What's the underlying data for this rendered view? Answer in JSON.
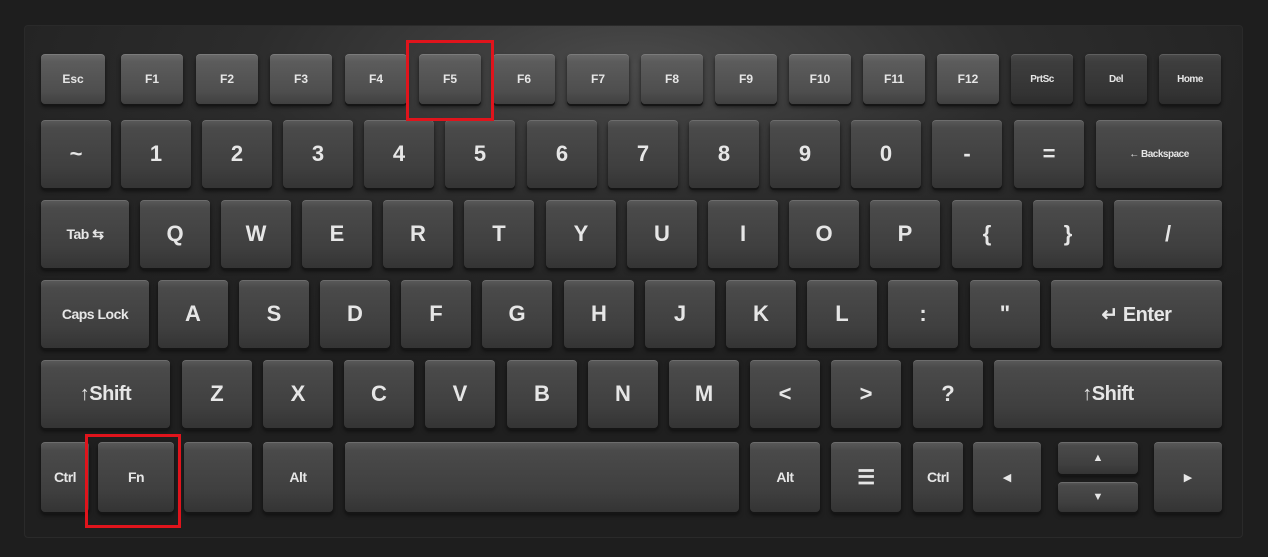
{
  "keyboard": {
    "row_function": [
      "Esc",
      "F1",
      "F2",
      "F3",
      "F4",
      "F5",
      "F6",
      "F7",
      "F8",
      "F9",
      "F10",
      "F11",
      "F12",
      "PrtSc",
      "Del",
      "Home"
    ],
    "row_number": [
      "~",
      "1",
      "2",
      "3",
      "4",
      "5",
      "6",
      "7",
      "8",
      "9",
      "0",
      "-",
      "=",
      "← Backspace"
    ],
    "row_qwerty": [
      "Tab ⇆",
      "Q",
      "W",
      "E",
      "R",
      "T",
      "Y",
      "U",
      "I",
      "O",
      "P",
      "{",
      "}",
      "/"
    ],
    "row_home": [
      "Caps Lock",
      "A",
      "S",
      "D",
      "F",
      "G",
      "H",
      "J",
      "K",
      "L",
      ":",
      "\"",
      "↵ Enter"
    ],
    "row_shift": [
      "↑Shift",
      "Z",
      "X",
      "C",
      "V",
      "B",
      "N",
      "M",
      "<",
      ">",
      "?",
      "↑Shift"
    ],
    "row_bottom": {
      "ctrl_left": "Ctrl",
      "fn": "Fn",
      "blank": "",
      "alt_left": "Alt",
      "space": "",
      "alt_right": "Alt",
      "menu": "☰",
      "ctrl_right": "Ctrl",
      "arrow_left": "◀",
      "arrow_up": "▲",
      "arrow_down": "▼",
      "arrow_right": "▶"
    }
  },
  "highlights": [
    "F5",
    "Fn"
  ],
  "colors": {
    "highlight": "#e0141c",
    "key": "#3f3f3f",
    "legend": "#e6e6e6"
  }
}
